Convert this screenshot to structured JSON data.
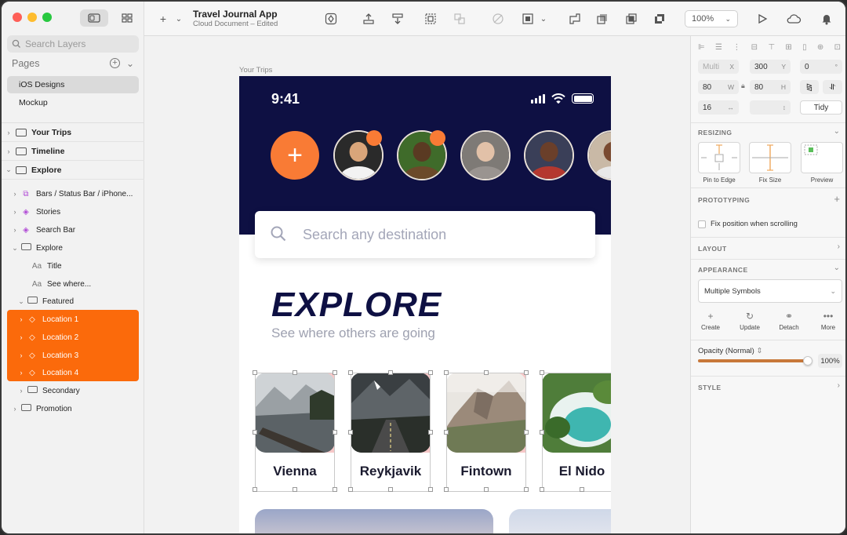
{
  "sidebar": {
    "search_placeholder": "Search Layers",
    "pages_label": "Pages",
    "pages": [
      {
        "label": "iOS Designs",
        "active": true
      },
      {
        "label": "Mockup",
        "active": false
      }
    ],
    "artboards": [
      "Your Trips",
      "Timeline",
      "Explore"
    ],
    "layers": [
      {
        "label": "Bars / Status Bar / iPhone...",
        "kind": "symbol-stack"
      },
      {
        "label": "Stories",
        "kind": "symbol"
      },
      {
        "label": "Search Bar",
        "kind": "symbol"
      },
      {
        "label": "Explore",
        "kind": "group"
      },
      {
        "label": "Title",
        "kind": "text"
      },
      {
        "label": "See where...",
        "kind": "text"
      },
      {
        "label": "Featured",
        "kind": "group"
      },
      {
        "label": "Location 1",
        "kind": "symbol"
      },
      {
        "label": "Location 2",
        "kind": "symbol"
      },
      {
        "label": "Location 3",
        "kind": "symbol"
      },
      {
        "label": "Location 4",
        "kind": "symbol"
      },
      {
        "label": "Secondary",
        "kind": "group"
      },
      {
        "label": "Promotion",
        "kind": "group"
      }
    ],
    "text_icon_label": "Aa"
  },
  "toolbar": {
    "doc_title": "Travel Journal App",
    "doc_subtitle": "Cloud Document – Edited",
    "zoom": "100%"
  },
  "canvas": {
    "artboard_label": "Your Trips",
    "phone": {
      "time": "9:41",
      "add_story": "+",
      "search_placeholder": "Search any destination",
      "title": "EXPLORE",
      "subtitle": "See where others are going",
      "cards": [
        "Vienna",
        "Reykjavik",
        "Fintown",
        "El Nido"
      ]
    }
  },
  "inspector": {
    "x": "Multi",
    "x_unit": "X",
    "y": "300",
    "y_unit": "Y",
    "rotation": "0",
    "rotation_unit": "°",
    "w": "80",
    "w_unit": "W",
    "h": "80",
    "h_unit": "H",
    "spacing": "16",
    "tidy": "Tidy",
    "resizing_title": "RESIZING",
    "resize_options": [
      "Pin to Edge",
      "Fix Size",
      "Preview"
    ],
    "prototyping_title": "PROTOTYPING",
    "fix_position_label": "Fix position when scrolling",
    "layout_title": "LAYOUT",
    "appearance_title": "APPEARANCE",
    "symbol_select": "Multiple Symbols",
    "symbol_actions": [
      "Create",
      "Update",
      "Detach",
      "More"
    ],
    "opacity_label": "Opacity (Normal)",
    "opacity_value": "100%",
    "opacity_fraction": 1.0,
    "style_title": "STYLE"
  },
  "colors": {
    "accent_orange": "#fb6a0b",
    "navy": "#0e1043",
    "story_orange": "#f97b35"
  }
}
